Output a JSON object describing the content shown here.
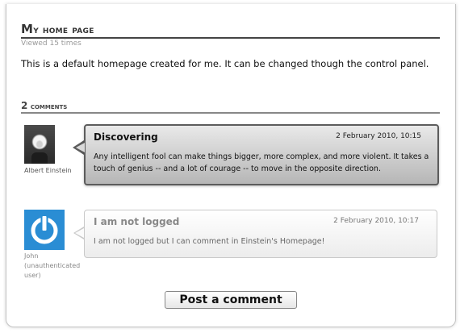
{
  "page": {
    "title_first": "M",
    "title_rest": "y home page",
    "views": "Viewed 15 times",
    "intro": "This is a default homepage created for me. It can be changed though the control panel."
  },
  "comments_header": {
    "count": "2",
    "label": " comments"
  },
  "comments": [
    {
      "author": "Albert Einstein",
      "title": "Discovering",
      "date": "2 February 2010, 10:15",
      "body": "Any intelligent fool can make things bigger, more complex, and more violent. It takes a touch of genius -- and a lot of courage -- to move in the opposite direction."
    },
    {
      "author_line1": "John",
      "author_line2": "(unauthenticated",
      "author_line3": "user)",
      "title": "I am not logged",
      "date": "2 February 2010, 10:17",
      "body": "I am not logged but I can comment in Einstein's Homepage!"
    }
  ],
  "actions": {
    "post_comment": "Post a comment"
  },
  "colors": {
    "anon_avatar_bg": "#2a8dd4",
    "einstein_bubble_border": "#5c5c5c"
  },
  "icons": {
    "anon_avatar": "power-icon"
  }
}
